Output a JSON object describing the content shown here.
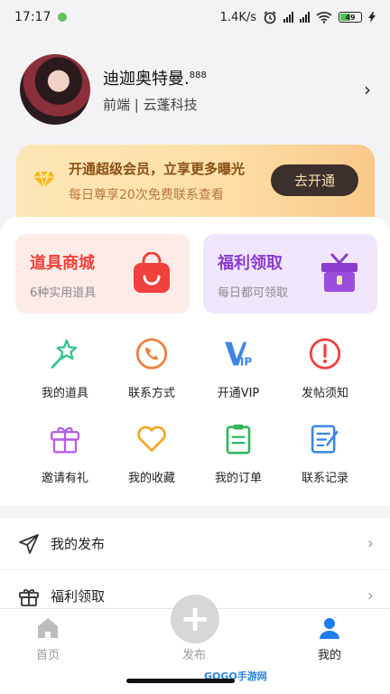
{
  "status_bar": {
    "time": "17:17",
    "network_speed": "1.4K/s",
    "battery": "49"
  },
  "profile": {
    "name": "迪迦奥特曼.",
    "name_suffix": "888",
    "subtitle": "前端 | 云蓬科技",
    "chevron": "›"
  },
  "vip_banner": {
    "title": "开通超级会员，立享更多曝光",
    "subtitle": "每日尊享20次免费联系查看",
    "button": "去开通",
    "accent_color": "#8a4f14"
  },
  "promos": [
    {
      "title": "道具商城",
      "subtitle": "6种实用道具",
      "icon": "shopping-bag-icon",
      "color": "#f0413c"
    },
    {
      "title": "福利领取",
      "subtitle": "每日都可领取",
      "icon": "gift-box-icon",
      "color": "#8a3ccf"
    }
  ],
  "grid": [
    {
      "label": "我的道具",
      "icon": "magic-wand-star-icon"
    },
    {
      "label": "联系方式",
      "icon": "phone-icon"
    },
    {
      "label": "开通VIP",
      "icon": "vip-icon"
    },
    {
      "label": "发帖须知",
      "icon": "alert-circle-icon"
    },
    {
      "label": "邀请有礼",
      "icon": "gift-icon"
    },
    {
      "label": "我的收藏",
      "icon": "heart-icon"
    },
    {
      "label": "我的订单",
      "icon": "clipboard-icon"
    },
    {
      "label": "联系记录",
      "icon": "note-edit-icon"
    }
  ],
  "list": [
    {
      "label": "我的发布",
      "icon": "send-icon",
      "chevron": "›"
    },
    {
      "label": "福利领取",
      "icon": "gift-outline-icon",
      "chevron": "›"
    }
  ],
  "tab_bar": {
    "home": "首页",
    "publish": "发布",
    "publish_symbol": "+",
    "me": "我的",
    "active_color": "#1e7bf0"
  },
  "watermark": "GOGO手游网"
}
